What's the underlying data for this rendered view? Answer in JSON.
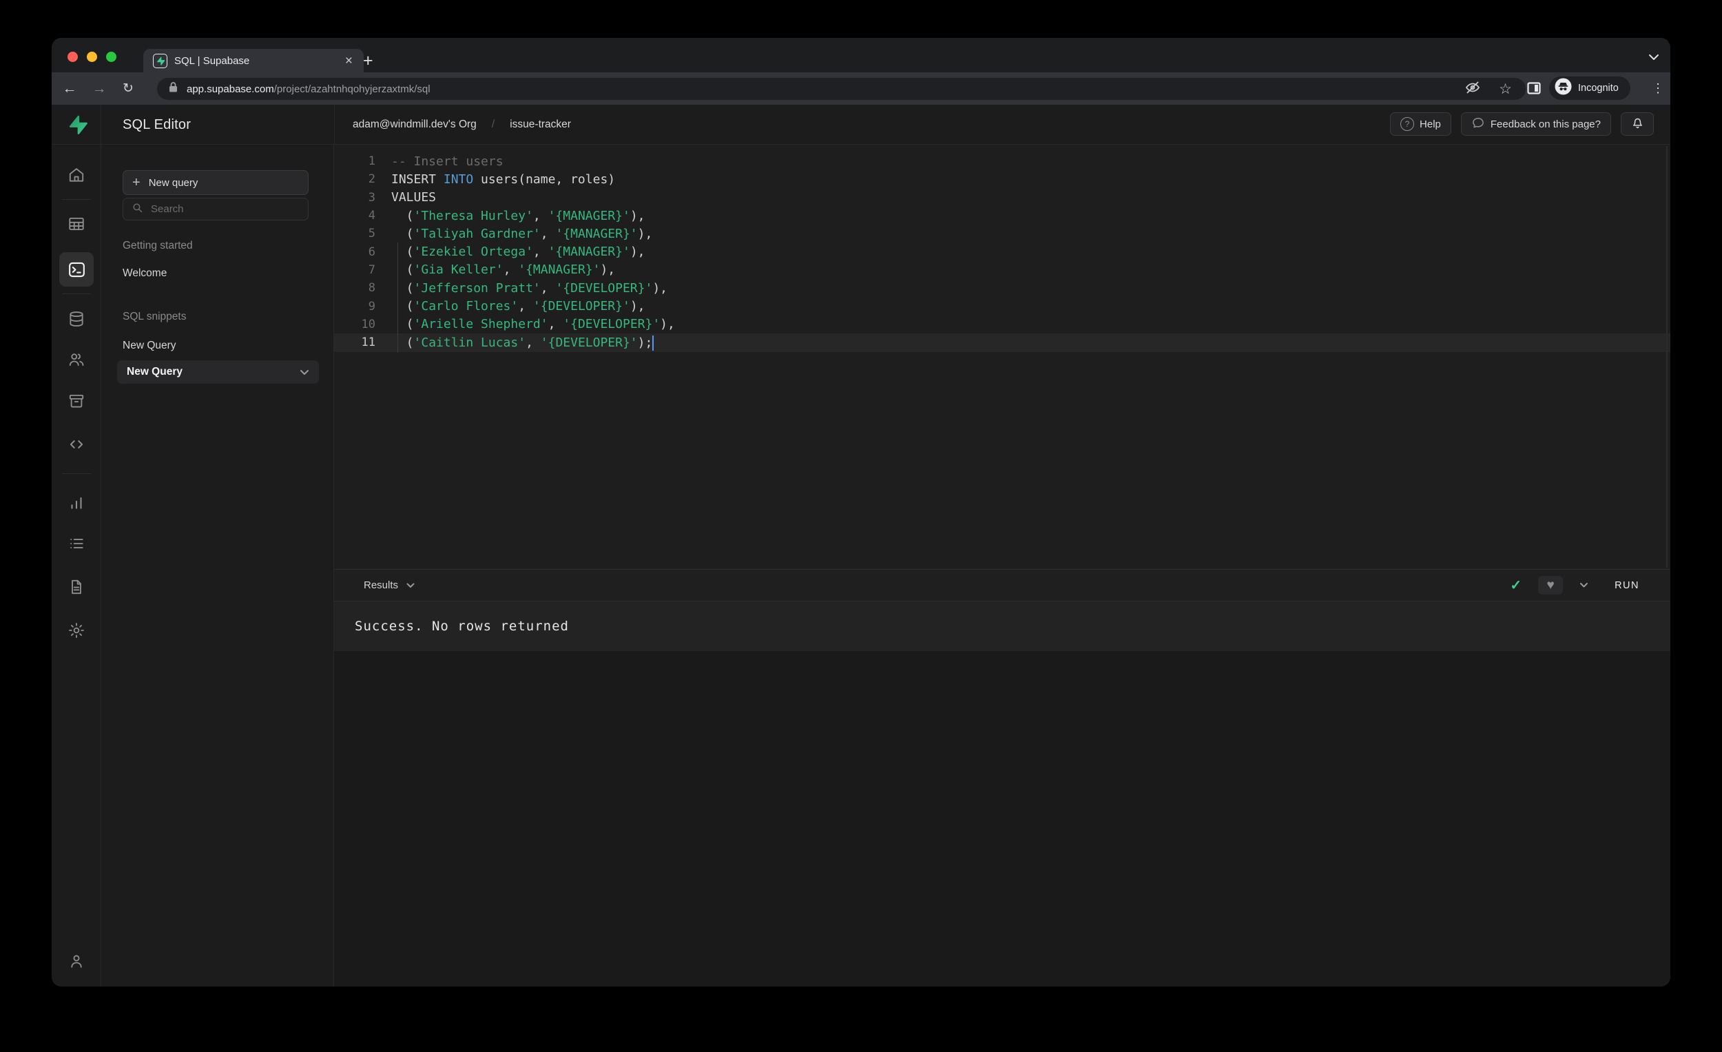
{
  "browser": {
    "tab_title": "SQL | Supabase",
    "url_host": "app.supabase.com",
    "url_path": "/project/azahtnhqohyjerzaxtmk/sql",
    "incognito_label": "Incognito",
    "close_glyph": "×",
    "new_tab_glyph": "+",
    "back_glyph": "←",
    "forward_glyph": "→",
    "reload_glyph": "↻",
    "menu_glyph": "⋮"
  },
  "header": {
    "app_title": "SQL Editor",
    "breadcrumb_org": "adam@windmill.dev's Org",
    "breadcrumb_separator": "/",
    "breadcrumb_project": "issue-tracker",
    "help_label": "Help",
    "help_icon_glyph": "?",
    "feedback_label": "Feedback on this page?"
  },
  "rail": {
    "items": [
      "home",
      "table-editor",
      "sql-editor",
      "database",
      "authentication",
      "storage",
      "edge-functions",
      "reports",
      "logs",
      "api-docs",
      "settings",
      "profile"
    ],
    "active_item": "sql-editor"
  },
  "sidebar": {
    "new_query_button": "New query",
    "new_query_plus": "+",
    "search_placeholder": "Search",
    "sections": [
      {
        "label": "Getting started",
        "items": [
          "Welcome"
        ]
      },
      {
        "label": "SQL snippets",
        "items": [
          "New Query"
        ]
      }
    ],
    "selected_item": "New Query"
  },
  "editor": {
    "language": "sql",
    "cursor_line": 11,
    "colors": {
      "string": "#36b77f",
      "keyword_blue": "#569cd6",
      "comment": "#6b6b6b",
      "plain": "#d4d4d4",
      "cursor": "#5596f6",
      "accent_green": "#3ecf8e"
    },
    "lines": [
      {
        "n": 1,
        "tokens": [
          {
            "t": "-- Insert users",
            "c": "cm"
          }
        ]
      },
      {
        "n": 2,
        "tokens": [
          {
            "t": "INSERT ",
            "c": "pl"
          },
          {
            "t": "INTO",
            "c": "kb"
          },
          {
            "t": " users(name, roles)",
            "c": "pl"
          }
        ]
      },
      {
        "n": 3,
        "tokens": [
          {
            "t": "VALUES",
            "c": "pl"
          }
        ]
      },
      {
        "n": 4,
        "tokens": [
          {
            "t": "  (",
            "c": "pl"
          },
          {
            "t": "'Theresa Hurley'",
            "c": "st"
          },
          {
            "t": ", ",
            "c": "pl"
          },
          {
            "t": "'{MANAGER}'",
            "c": "st"
          },
          {
            "t": "),",
            "c": "pl"
          }
        ]
      },
      {
        "n": 5,
        "tokens": [
          {
            "t": "  (",
            "c": "pl"
          },
          {
            "t": "'Taliyah Gardner'",
            "c": "st"
          },
          {
            "t": ", ",
            "c": "pl"
          },
          {
            "t": "'{MANAGER}'",
            "c": "st"
          },
          {
            "t": "),",
            "c": "pl"
          }
        ]
      },
      {
        "n": 6,
        "tokens": [
          {
            "t": "  (",
            "c": "pl"
          },
          {
            "t": "'Ezekiel Ortega'",
            "c": "st"
          },
          {
            "t": ", ",
            "c": "pl"
          },
          {
            "t": "'{MANAGER}'",
            "c": "st"
          },
          {
            "t": "),",
            "c": "pl"
          }
        ]
      },
      {
        "n": 7,
        "tokens": [
          {
            "t": "  (",
            "c": "pl"
          },
          {
            "t": "'Gia Keller'",
            "c": "st"
          },
          {
            "t": ", ",
            "c": "pl"
          },
          {
            "t": "'{MANAGER}'",
            "c": "st"
          },
          {
            "t": "),",
            "c": "pl"
          }
        ]
      },
      {
        "n": 8,
        "tokens": [
          {
            "t": "  (",
            "c": "pl"
          },
          {
            "t": "'Jefferson Pratt'",
            "c": "st"
          },
          {
            "t": ", ",
            "c": "pl"
          },
          {
            "t": "'{DEVELOPER}'",
            "c": "st"
          },
          {
            "t": "),",
            "c": "pl"
          }
        ]
      },
      {
        "n": 9,
        "tokens": [
          {
            "t": "  (",
            "c": "pl"
          },
          {
            "t": "'Carlo Flores'",
            "c": "st"
          },
          {
            "t": ", ",
            "c": "pl"
          },
          {
            "t": "'{DEVELOPER}'",
            "c": "st"
          },
          {
            "t": "),",
            "c": "pl"
          }
        ]
      },
      {
        "n": 10,
        "tokens": [
          {
            "t": "  (",
            "c": "pl"
          },
          {
            "t": "'Arielle Shepherd'",
            "c": "st"
          },
          {
            "t": ", ",
            "c": "pl"
          },
          {
            "t": "'{DEVELOPER}'",
            "c": "st"
          },
          {
            "t": "),",
            "c": "pl"
          }
        ]
      },
      {
        "n": 11,
        "tokens": [
          {
            "t": "  (",
            "c": "pl"
          },
          {
            "t": "'Caitlin Lucas'",
            "c": "st"
          },
          {
            "t": ", ",
            "c": "pl"
          },
          {
            "t": "'{DEVELOPER}'",
            "c": "st"
          },
          {
            "t": ");",
            "c": "pl"
          }
        ]
      }
    ]
  },
  "results": {
    "tab_label": "Results",
    "run_label": "RUN",
    "success_check_glyph": "✓",
    "favorite_glyph": "♥",
    "message": "Success. No rows returned"
  }
}
